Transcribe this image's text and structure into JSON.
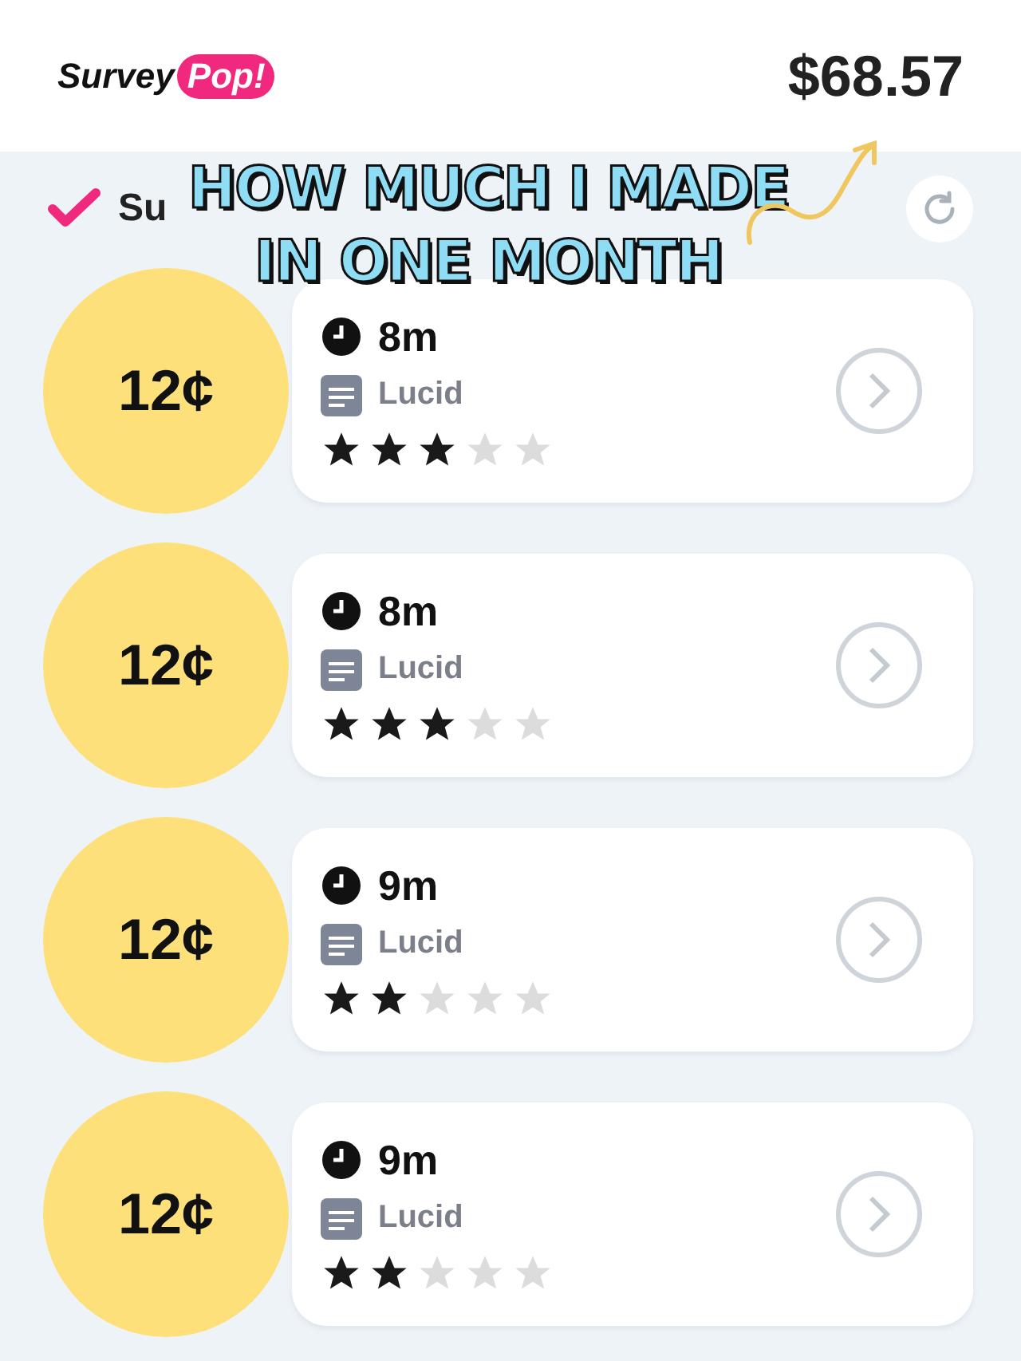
{
  "header": {
    "logo": {
      "word": "Survey",
      "accent": "Pop!"
    },
    "balance": "$68.57"
  },
  "section": {
    "title": "Su"
  },
  "overlay": {
    "lines": [
      "HOW MUCH I MADE",
      "IN ONE MONTH"
    ]
  },
  "surveys": [
    {
      "reward": "12¢",
      "time": "8m",
      "provider": "Lucid",
      "stars": 3
    },
    {
      "reward": "12¢",
      "time": "8m",
      "provider": "Lucid",
      "stars": 3
    },
    {
      "reward": "12¢",
      "time": "9m",
      "provider": "Lucid",
      "stars": 2
    },
    {
      "reward": "12¢",
      "time": "9m",
      "provider": "Lucid",
      "stars": 2
    }
  ]
}
